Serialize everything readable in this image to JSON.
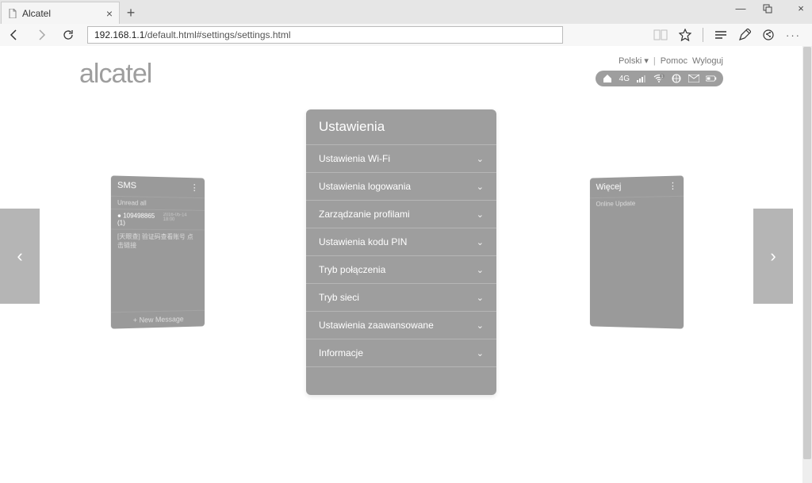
{
  "browser": {
    "tab_title": "Alcatel",
    "url_host": "192.168.1.1",
    "url_path": "/default.html#settings/settings.html"
  },
  "top_links": {
    "language": "Polski",
    "help": "Pomoc",
    "logout": "Wyloguj"
  },
  "logo": "alcatel",
  "status": {
    "net": "4G"
  },
  "carousel": {
    "left_card": {
      "title": "SMS",
      "sub": "Unread all",
      "row1": "109498865 (1)",
      "row1_time": "2016-05-14 18:00",
      "row2": "[天眼查] 验证码查看账号 点击链接",
      "footer": "+ New Message"
    },
    "right_card": {
      "title": "Więcej",
      "row1": "Online Update"
    }
  },
  "settings": {
    "title": "Ustawienia",
    "items": [
      {
        "label": "Ustawienia Wi-Fi"
      },
      {
        "label": "Ustawienia logowania"
      },
      {
        "label": "Zarządzanie profilami"
      },
      {
        "label": "Ustawienia kodu PIN"
      },
      {
        "label": "Tryb połączenia"
      },
      {
        "label": "Tryb sieci"
      },
      {
        "label": "Ustawienia zaawansowane"
      },
      {
        "label": "Informacje"
      }
    ]
  }
}
